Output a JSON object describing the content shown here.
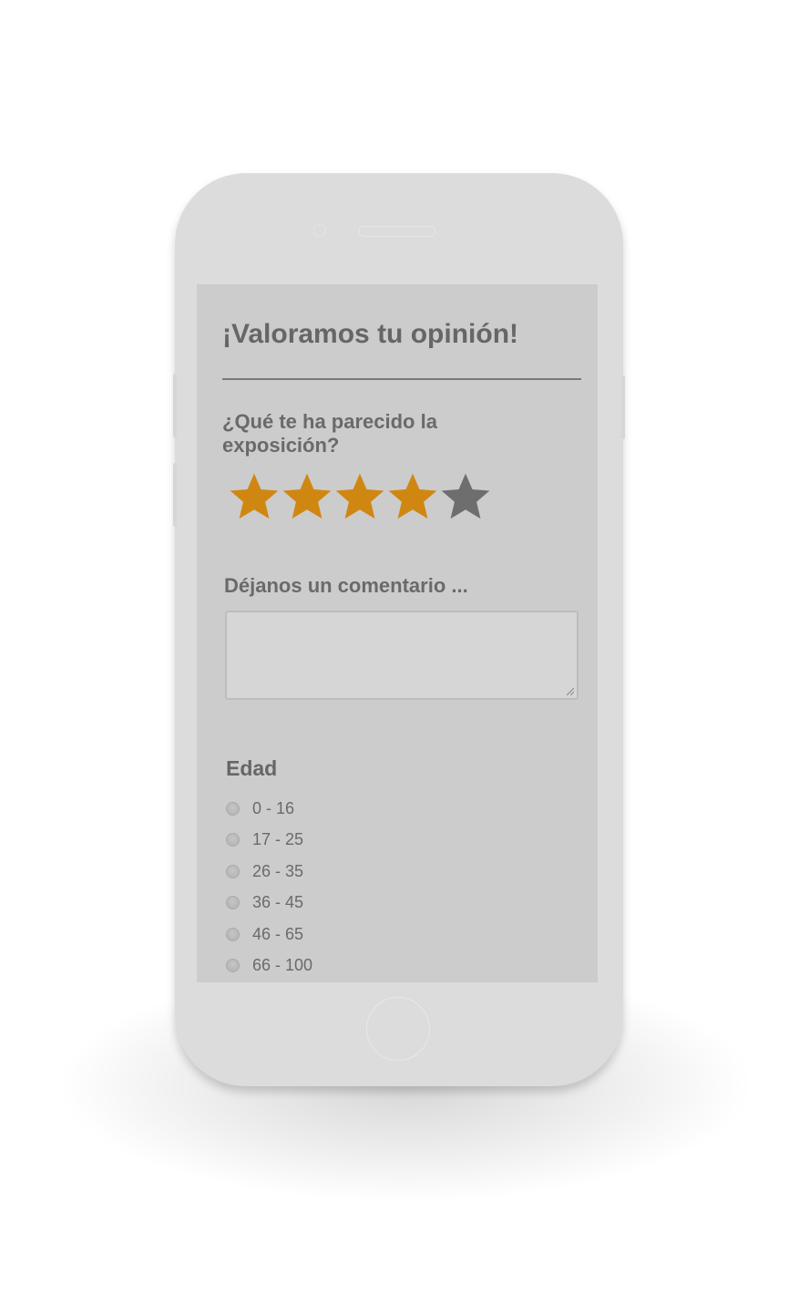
{
  "form": {
    "title": "¡Valoramos tu opinión!",
    "question": "¿Qué te ha parecido la exposición?",
    "rating": {
      "value": 4,
      "max": 5,
      "filled_color": "#d08712",
      "empty_color": "#6e6e6e"
    },
    "comment_label": "Déjanos un comentario ...",
    "comment_value": "",
    "age_label": "Edad",
    "age_options": [
      "0 - 16",
      "17 - 25",
      "26 - 35",
      "36 - 45",
      "46 - 65",
      "66 - 100"
    ]
  }
}
